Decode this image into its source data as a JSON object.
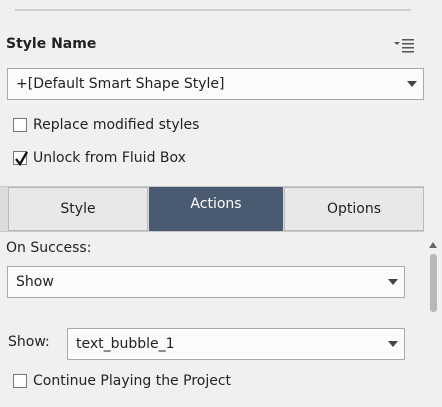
{
  "style_section": {
    "title": "Style Name",
    "style_dropdown_value": "+[Default Smart Shape Style]",
    "replace_modified_label": "Replace modified styles",
    "replace_modified_checked": false,
    "unlock_fluid_box_label": "Unlock from Fluid Box",
    "unlock_fluid_box_checked": true
  },
  "tabs": [
    {
      "label": "Style",
      "active": false
    },
    {
      "label": "Actions",
      "active": true
    },
    {
      "label": "Options",
      "active": false
    }
  ],
  "actions": {
    "on_success_label": "On Success:",
    "on_success_value": "Show",
    "show_label": "Show:",
    "show_value": "text_bubble_1",
    "continue_playing_label": "Continue Playing the Project",
    "continue_playing_checked": false
  },
  "colors": {
    "active_tab": "#4a5a70",
    "panel_bg": "#f0f0f0"
  },
  "icons": {
    "panel_menu": "list-menu-icon",
    "dropdown_arrow": "chevron-down-icon",
    "check": "checkmark-icon",
    "scroll_up": "arrow-up-icon"
  }
}
